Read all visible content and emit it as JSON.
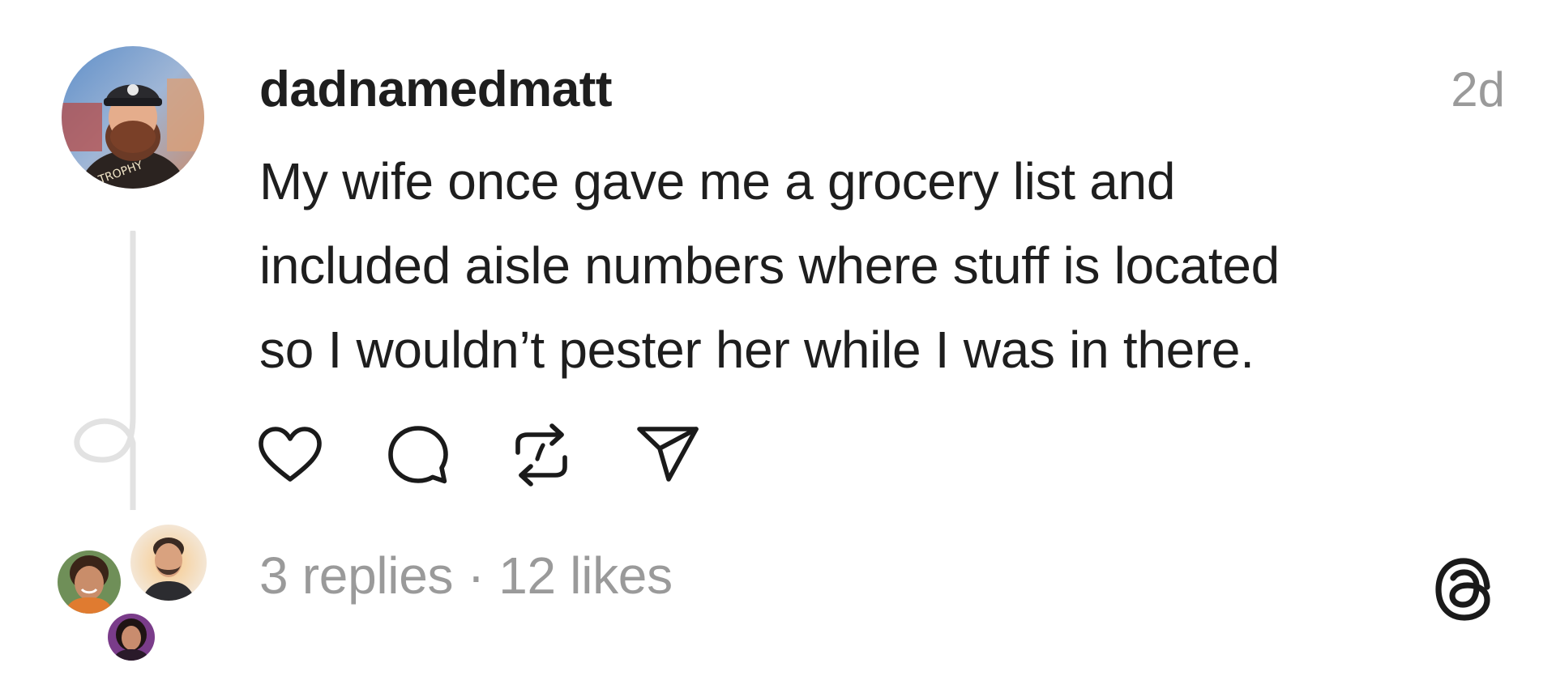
{
  "post": {
    "username": "dadnamedmatt",
    "timestamp": "2d",
    "text_lines": [
      "My wife once gave me a grocery list and",
      "included aisle numbers where stuff is located",
      "so I wouldn’t pester her while I was in there."
    ]
  },
  "actions": {
    "icons": [
      "heart-icon",
      "comment-icon",
      "repost-icon",
      "share-icon"
    ]
  },
  "stats": {
    "replies": "3 replies",
    "separator": "·",
    "likes": "12 likes"
  },
  "colors": {
    "text": "#1e1e1e",
    "muted": "#9a9a9a",
    "thread_line": "#e2e2e2"
  }
}
